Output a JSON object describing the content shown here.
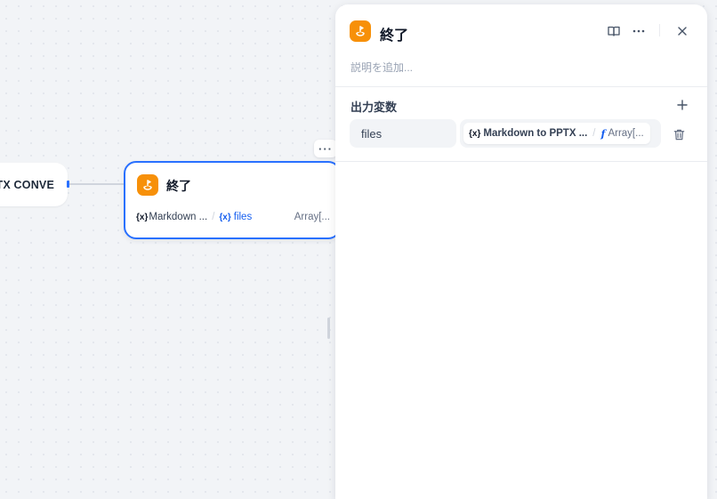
{
  "canvas": {
    "prev_node": {
      "label": "TX CONVE"
    },
    "end_node": {
      "title": "終了",
      "icon": "end-flag-icon",
      "variable": {
        "source": "Markdown ...",
        "separator": "/",
        "name": "files",
        "type": "Array[..."
      }
    },
    "more_label": "···"
  },
  "panel": {
    "title": "終了",
    "icon": "end-flag-icon",
    "description_placeholder": "説明を追加...",
    "section_title": "出力変数",
    "outputs": [
      {
        "name": "files",
        "source": "Markdown to PPTX ...",
        "separator": "/",
        "type": "Array[..."
      }
    ]
  },
  "colors": {
    "accent": "#2970ff",
    "node_icon": "#f79009",
    "variable_blue": "#155eef"
  }
}
